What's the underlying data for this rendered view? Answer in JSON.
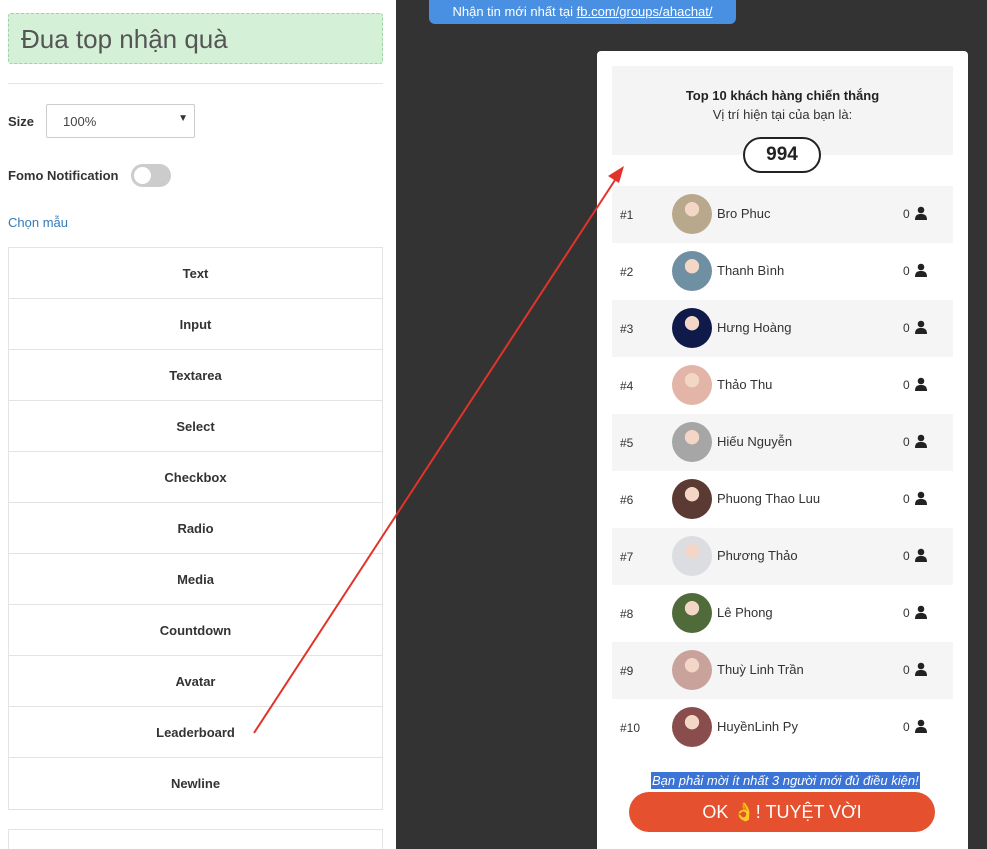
{
  "editor": {
    "title": "Đua top nhận quà",
    "size_label": "Size",
    "size_value": "100%",
    "fomo_label": "Fomo Notification",
    "fomo_enabled": false,
    "template_link": "Chọn mẫu",
    "blocks": [
      "Text",
      "Input",
      "Textarea",
      "Select",
      "Checkbox",
      "Radio",
      "Media",
      "Countdown",
      "Avatar",
      "Leaderboard",
      "Newline"
    ]
  },
  "banner": {
    "text": "Nhận tin mới nhất tại ",
    "link": "fb.com/groups/ahachat/"
  },
  "leaderboard": {
    "heading": "Top 10 khách hàng chiến thắng",
    "subheading": "Vị trí hiện tại của bạn là:",
    "current_rank": "994",
    "rows": [
      {
        "rank": "#1",
        "name": "Bro Phuc",
        "score": "0",
        "avatar_color": "#b9a98c"
      },
      {
        "rank": "#2",
        "name": "Thanh Bình",
        "score": "0",
        "avatar_color": "#6f8fa3"
      },
      {
        "rank": "#3",
        "name": "Hưng Hoàng",
        "score": "0",
        "avatar_color": "#0f1a4a"
      },
      {
        "rank": "#4",
        "name": "Thảo Thu",
        "score": "0",
        "avatar_color": "#e3b5a8"
      },
      {
        "rank": "#5",
        "name": "Hiếu Nguyễn",
        "score": "0",
        "avatar_color": "#a6a6a6"
      },
      {
        "rank": "#6",
        "name": "Phuong Thao Luu",
        "score": "0",
        "avatar_color": "#5a3a32"
      },
      {
        "rank": "#7",
        "name": "Phương Thảo",
        "score": "0",
        "avatar_color": "#dcdde1"
      },
      {
        "rank": "#8",
        "name": "Lê Phong",
        "score": "0",
        "avatar_color": "#4f6b3a"
      },
      {
        "rank": "#9",
        "name": "Thuỳ Linh Trần",
        "score": "0",
        "avatar_color": "#c9a39b"
      },
      {
        "rank": "#10",
        "name": "HuyềnLinh Py",
        "score": "0",
        "avatar_color": "#8a4d4d"
      }
    ],
    "note": "Bạn phải mời ít nhất 3 người mới đủ điều kiện!",
    "button_label": "OK 👌! TUYỆT VỜI"
  }
}
